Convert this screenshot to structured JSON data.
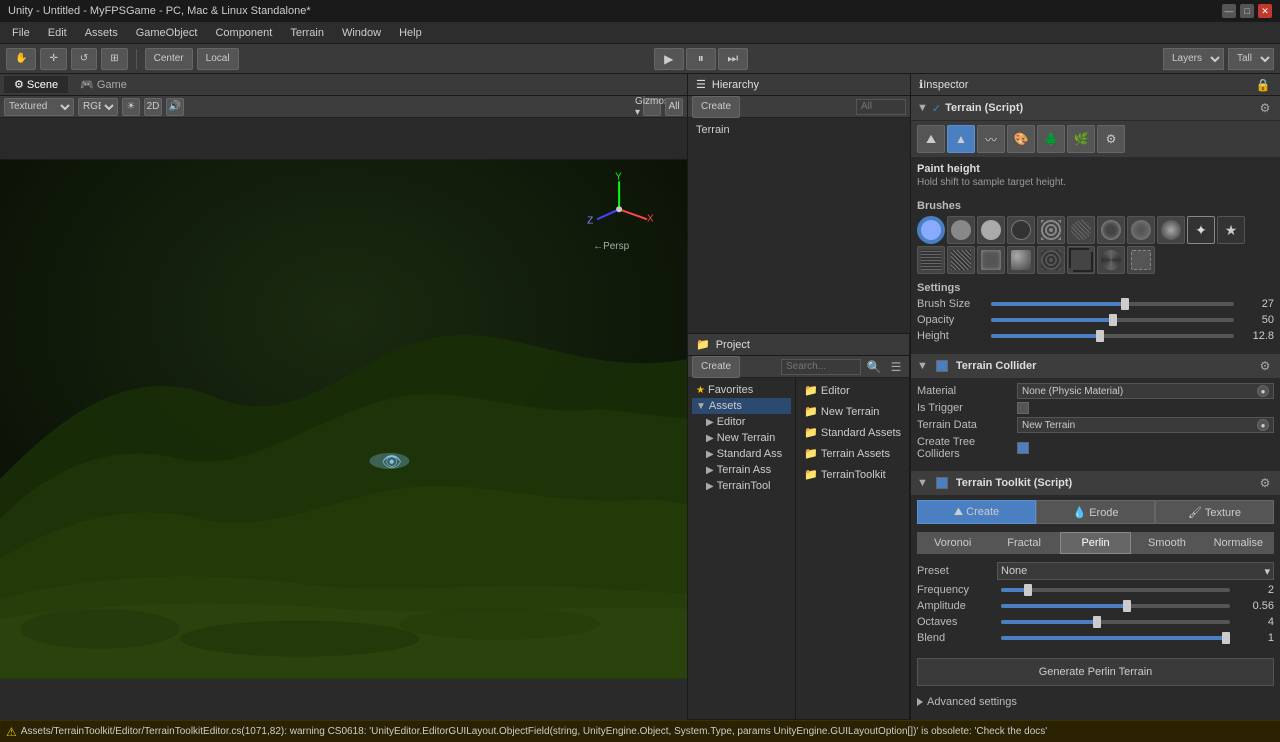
{
  "window": {
    "title": "Unity - Untitled - MyFPSGame - PC, Mac & Linux Standalone*"
  },
  "menu": {
    "items": [
      "File",
      "Edit",
      "Assets",
      "GameObject",
      "Component",
      "Terrain",
      "Window",
      "Help"
    ]
  },
  "toolbar": {
    "center_label": "Center",
    "local_label": "Local",
    "layers_label": "Layers",
    "tall_label": "Tall"
  },
  "scene_tabs": [
    "Scene",
    "Game"
  ],
  "scene_view": {
    "display_mode": "Textured",
    "color_mode": "RGB",
    "gizmos": "Gizmos",
    "all_filter": "All",
    "persp": "←Persp"
  },
  "hierarchy": {
    "title": "Hierarchy",
    "create_btn": "Create",
    "all_btn": "All",
    "items": [
      "Terrain"
    ]
  },
  "project": {
    "title": "Project",
    "create_btn": "Create",
    "tree": [
      {
        "label": "Favorites",
        "icon": "star"
      },
      {
        "label": "Assets",
        "icon": "folder",
        "selected": true
      },
      {
        "label": "Editor",
        "icon": "folder",
        "indent": 1
      },
      {
        "label": "New Terrain",
        "icon": "folder",
        "indent": 1
      },
      {
        "label": "Standard Ass",
        "icon": "folder",
        "indent": 1
      },
      {
        "label": "Terrain Ass",
        "icon": "folder",
        "indent": 1
      },
      {
        "label": "TerrainTool",
        "icon": "folder",
        "indent": 1
      }
    ],
    "files": [
      {
        "name": "Editor",
        "icon": "folder"
      },
      {
        "name": "New Terrain",
        "icon": "folder"
      },
      {
        "name": "Standard Assets",
        "icon": "folder"
      },
      {
        "name": "Terrain Assets",
        "icon": "folder"
      },
      {
        "name": "TerrainToolkit",
        "icon": "folder"
      }
    ]
  },
  "inspector": {
    "title": "Inspector",
    "component_script": "Terrain (Script)",
    "paint_height_title": "Paint height",
    "paint_height_subtitle": "Hold shift to sample target height.",
    "brushes_title": "Brushes",
    "settings_title": "Settings",
    "brush_size_label": "Brush Size",
    "brush_size_value": "27",
    "brush_size_pct": 55,
    "opacity_label": "Opacity",
    "opacity_value": "50",
    "opacity_pct": 50,
    "height_label": "Height",
    "height_value": "12.8",
    "height_pct": 45,
    "terrain_collider_title": "Terrain Collider",
    "material_label": "Material",
    "material_value": "None (Physic Material)",
    "is_trigger_label": "Is Trigger",
    "terrain_data_label": "Terrain Data",
    "terrain_data_value": "New Terrain",
    "create_tree_label": "Create Tree Colliders",
    "toolkit_title": "Terrain Toolkit (Script)",
    "toolkit_tabs": [
      "Create",
      "Erode",
      "Texture"
    ],
    "noise_tabs": [
      "Voronoi",
      "Fractal",
      "Perlin",
      "Smooth",
      "Normalise"
    ],
    "preset_label": "Preset",
    "preset_value": "None",
    "frequency_label": "Frequency",
    "frequency_value": "2",
    "frequency_pct": 12,
    "amplitude_label": "Amplitude",
    "amplitude_value": "0.56",
    "amplitude_pct": 55,
    "octaves_label": "Octaves",
    "octaves_value": "4",
    "octaves_pct": 42,
    "blend_label": "Blend",
    "blend_value": "1",
    "blend_pct": 100,
    "generate_btn": "Generate Perlin Terrain",
    "advanced_label": "Advanced settings"
  },
  "warning": {
    "text": "Assets/TerrainToolkit/Editor/TerrainToolkitEditor.cs(1071,82): warning CS0618: 'UnityEditor.EditorGUILayout.ObjectField(string, UnityEngine.Object, System.Type, params UnityEngine.GUILayoutOption[])' is obsolete: 'Check the docs'"
  }
}
